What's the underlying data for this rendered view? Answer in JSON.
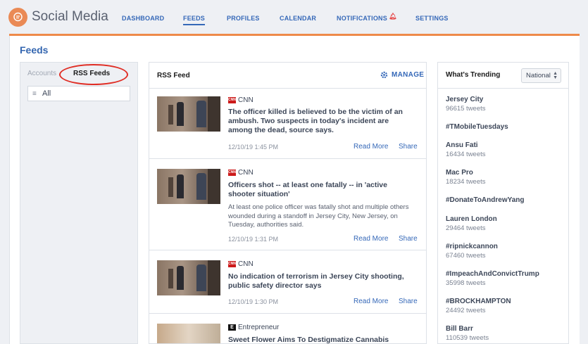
{
  "app": {
    "title": "Social Media"
  },
  "nav": [
    {
      "label": "DASHBOARD"
    },
    {
      "label": "FEEDS"
    },
    {
      "label": "PROFILES"
    },
    {
      "label": "CALENDAR"
    },
    {
      "label": "NOTIFICATIONS"
    },
    {
      "label": "SETTINGS"
    }
  ],
  "page": {
    "title": "Feeds"
  },
  "left": {
    "tab_accounts": "Accounts",
    "tab_rss": "RSS Feeds",
    "all_label": "All"
  },
  "center": {
    "title": "RSS Feed",
    "manage_label": "MANAGE",
    "items": [
      {
        "source": "CNN",
        "headline": "The officer killed is believed to be the victim of an ambush. Two suspects in today's incident are among the dead, source says.",
        "summary": "",
        "date": "12/10/19 1:45 PM",
        "read_more": "Read More",
        "share": "Share"
      },
      {
        "source": "CNN",
        "headline": "Officers shot -- at least one fatally -- in 'active shooter situation'",
        "summary": "At least one police officer was fatally shot and multiple others wounded during a standoff in Jersey City, New Jersey, on Tuesday, authorities said.",
        "date": "12/10/19 1:31 PM",
        "read_more": "Read More",
        "share": "Share"
      },
      {
        "source": "CNN",
        "headline": "No indication of terrorism in Jersey City shooting, public safety director says",
        "summary": "",
        "date": "12/10/19 1:30 PM",
        "read_more": "Read More",
        "share": "Share"
      },
      {
        "source": "Entrepreneur",
        "headline": "Sweet Flower Aims To Destigmatize Cannabis",
        "summary": "",
        "date": "",
        "read_more": "",
        "share": ""
      }
    ]
  },
  "right": {
    "title": "What's Trending",
    "region": "National",
    "trends": [
      {
        "name": "Jersey City",
        "count": "96615 tweets"
      },
      {
        "name": "#TMobileTuesdays",
        "count": ""
      },
      {
        "name": "Ansu Fati",
        "count": "16434 tweets"
      },
      {
        "name": "Mac Pro",
        "count": "18234 tweets"
      },
      {
        "name": "#DonateToAndrewYang",
        "count": ""
      },
      {
        "name": "Lauren London",
        "count": "29464 tweets"
      },
      {
        "name": "#ripnickcannon",
        "count": "67460 tweets"
      },
      {
        "name": "#ImpeachAndConvictTrump",
        "count": "35998 tweets"
      },
      {
        "name": "#BROCKHAMPTON",
        "count": "24492 tweets"
      },
      {
        "name": "Bill Barr",
        "count": "110539 tweets"
      }
    ]
  },
  "colors": {
    "accent": "#3568b8",
    "brand_orange": "#ee8a4a",
    "highlight_red": "#e02d24"
  }
}
